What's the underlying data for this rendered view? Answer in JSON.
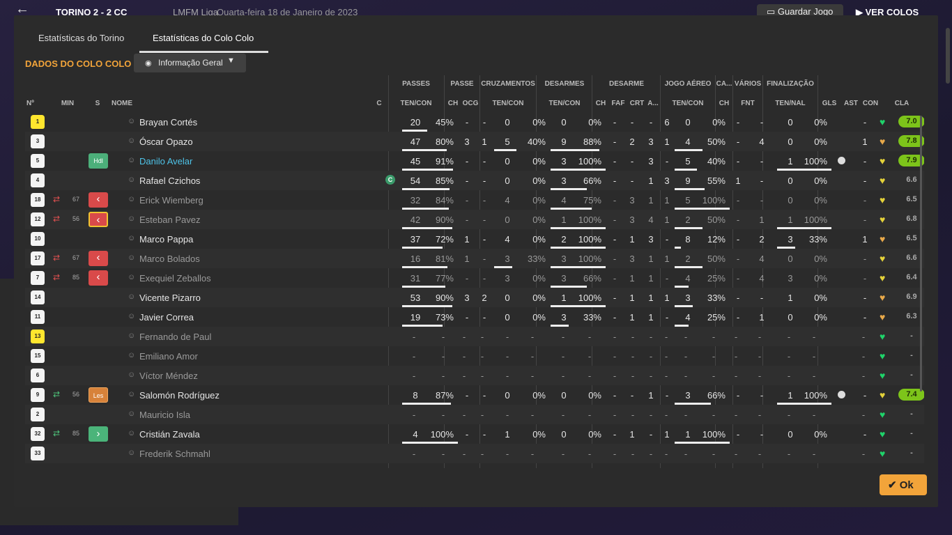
{
  "topbar": {
    "score": "TORINO  2 - 2  CC",
    "league": "LMFM Liga",
    "date": "Quarta-feira 18 de Janeiro de 2023",
    "save_label": "Guardar Jogo",
    "next_label": "VER COLOS"
  },
  "tabs": [
    "Estatísticas do Torino",
    "Estatísticas do Colo Colo"
  ],
  "section_title": "DADOS DO COLO COLO",
  "dropdown": {
    "label": "Informação Geral"
  },
  "group_headers": [
    "PASSES",
    "PASSE",
    "CRUZAMENTOS",
    "DESARMES",
    "DESARME",
    "JOGO AÉREO",
    "CA...",
    "VÁRIOS",
    "FINALIZAÇÃO"
  ],
  "columns": [
    "Nº",
    "MIN",
    "S",
    "NOME",
    "C",
    "TEN/CON",
    "CH",
    "OCG",
    "TEN/CON",
    "TEN/CON",
    "CH",
    "FAF",
    "CRT",
    "A...",
    "TEN/CON",
    "CH",
    "FNT",
    "TEN/NAL",
    "GLS",
    "AST",
    "CON",
    "CLA"
  ],
  "colors": {
    "accent": "#f2a43a",
    "highlight_name": "#4ec3e8",
    "rating_green": "#7dc41a"
  },
  "players": [
    {
      "num": "1",
      "gk": true,
      "min": "",
      "sub": "",
      "badge": "",
      "name": "Brayan Cortés",
      "dim": false,
      "cap": false,
      "p": [
        "20",
        "45%"
      ],
      "pr": 0.45,
      "pch": "-",
      "pocg": "-",
      "cz": [
        "0",
        "0%"
      ],
      "czr": 0,
      "ds": [
        "0",
        "0%"
      ],
      "dsr": 0,
      "dch": "-",
      "faf": "-",
      "crt": "-",
      "a": "6",
      "ja": [
        "0",
        "0%"
      ],
      "jar": 0,
      "cach": "-",
      "fnt": "-",
      "fin": [
        "0",
        "0%"
      ],
      "finr": 0,
      "gls": false,
      "ast": "-",
      "con": "green",
      "cla": "7.0",
      "cla_hi": true
    },
    {
      "num": "3",
      "gk": false,
      "min": "",
      "sub": "",
      "badge": "",
      "name": "Óscar Opazo",
      "dim": false,
      "cap": false,
      "p": [
        "47",
        "80%"
      ],
      "pr": 0.8,
      "pch": "3",
      "pocg": "1",
      "cz": [
        "5",
        "40%"
      ],
      "czr": 0.4,
      "ds": [
        "9",
        "88%"
      ],
      "dsr": 0.88,
      "dch": "-",
      "faf": "2",
      "crt": "3",
      "a": "1",
      "ja": [
        "4",
        "50%"
      ],
      "jar": 0.5,
      "cach": "-",
      "fnt": "4",
      "fin": [
        "0",
        "0%"
      ],
      "finr": 0,
      "gls": false,
      "ast": "1",
      "con": "orange",
      "cla": "7.8",
      "cla_hi": true
    },
    {
      "num": "5",
      "gk": false,
      "min": "",
      "sub": "",
      "badge": "Hdl",
      "name": "Danilo Avelar",
      "dim": false,
      "blue": true,
      "cap": false,
      "p": [
        "45",
        "91%"
      ],
      "pr": 0.91,
      "pch": "-",
      "pocg": "-",
      "cz": [
        "0",
        "0%"
      ],
      "czr": 0,
      "ds": [
        "3",
        "100%"
      ],
      "dsr": 1,
      "dch": "-",
      "faf": "-",
      "crt": "3",
      "a": "-",
      "ja": [
        "5",
        "40%"
      ],
      "jar": 0.4,
      "cach": "-",
      "fnt": "-",
      "fin": [
        "1",
        "100%"
      ],
      "finr": 1,
      "gls": true,
      "ast": "-",
      "con": "yellow",
      "cla": "7.9",
      "cla_hi": true
    },
    {
      "num": "4",
      "gk": false,
      "min": "",
      "sub": "",
      "badge": "",
      "name": "Rafael Czichos",
      "dim": false,
      "cap": true,
      "p": [
        "54",
        "85%"
      ],
      "pr": 0.85,
      "pch": "-",
      "pocg": "-",
      "cz": [
        "0",
        "0%"
      ],
      "czr": 0,
      "ds": [
        "3",
        "66%"
      ],
      "dsr": 0.66,
      "dch": "-",
      "faf": "-",
      "crt": "1",
      "a": "3",
      "ja": [
        "9",
        "55%"
      ],
      "jar": 0.55,
      "cach": "1",
      "fnt": "-",
      "fin": [
        "0",
        "0%"
      ],
      "finr": 0,
      "gls": false,
      "ast": "-",
      "con": "yellow",
      "cla": "6.6",
      "cla_hi": false
    },
    {
      "num": "18",
      "gk": false,
      "min": "67",
      "sub": "out",
      "badge": "red-out",
      "name": "Erick Wiemberg",
      "dim": true,
      "cap": false,
      "p": [
        "32",
        "84%"
      ],
      "pr": 0.84,
      "pch": "-",
      "pocg": "-",
      "cz": [
        "4",
        "0%"
      ],
      "czr": 0,
      "ds": [
        "4",
        "75%"
      ],
      "dsr": 0.75,
      "dch": "-",
      "faf": "3",
      "crt": "1",
      "a": "1",
      "ja": [
        "5",
        "100%"
      ],
      "jar": 1,
      "cach": "-",
      "fnt": "-",
      "fin": [
        "0",
        "0%"
      ],
      "finr": 0,
      "gls": false,
      "ast": "-",
      "con": "yellow",
      "cla": "6.5",
      "cla_hi": false
    },
    {
      "num": "12",
      "gk": false,
      "min": "56",
      "sub": "out",
      "badge": "red-out-y",
      "name": "Esteban Pavez",
      "dim": true,
      "cap": false,
      "p": [
        "42",
        "90%"
      ],
      "pr": 0.9,
      "pch": "-",
      "pocg": "-",
      "cz": [
        "0",
        "0%"
      ],
      "czr": 0,
      "ds": [
        "1",
        "100%"
      ],
      "dsr": 1,
      "dch": "-",
      "faf": "3",
      "crt": "4",
      "a": "1",
      "ja": [
        "2",
        "50%"
      ],
      "jar": 0.5,
      "cach": "-",
      "fnt": "1",
      "fin": [
        "1",
        "100%"
      ],
      "finr": 1,
      "gls": false,
      "ast": "-",
      "con": "yellow",
      "cla": "6.8",
      "cla_hi": false
    },
    {
      "num": "10",
      "gk": false,
      "min": "",
      "sub": "",
      "badge": "",
      "name": "Marco Pappa",
      "dim": false,
      "cap": false,
      "p": [
        "37",
        "72%"
      ],
      "pr": 0.72,
      "pch": "1",
      "pocg": "-",
      "cz": [
        "4",
        "0%"
      ],
      "czr": 0,
      "ds": [
        "2",
        "100%"
      ],
      "dsr": 1,
      "dch": "-",
      "faf": "1",
      "crt": "3",
      "a": "-",
      "ja": [
        "8",
        "12%"
      ],
      "jar": 0.12,
      "cach": "-",
      "fnt": "2",
      "fin": [
        "3",
        "33%"
      ],
      "finr": 0.33,
      "gls": false,
      "ast": "1",
      "con": "orange",
      "cla": "6.5",
      "cla_hi": false
    },
    {
      "num": "17",
      "gk": false,
      "min": "67",
      "sub": "out",
      "badge": "red-out",
      "name": "Marco Bolados",
      "dim": true,
      "cap": false,
      "p": [
        "16",
        "81%"
      ],
      "pr": 0.81,
      "pch": "1",
      "pocg": "-",
      "cz": [
        "3",
        "33%"
      ],
      "czr": 0.33,
      "ds": [
        "3",
        "100%"
      ],
      "dsr": 1,
      "dch": "-",
      "faf": "3",
      "crt": "1",
      "a": "1",
      "ja": [
        "2",
        "50%"
      ],
      "jar": 0.5,
      "cach": "-",
      "fnt": "4",
      "fin": [
        "0",
        "0%"
      ],
      "finr": 0,
      "gls": false,
      "ast": "-",
      "con": "yellow",
      "cla": "6.6",
      "cla_hi": false
    },
    {
      "num": "7",
      "gk": false,
      "min": "85",
      "sub": "out",
      "badge": "red-out",
      "name": "Exequiel Zeballos",
      "dim": true,
      "cap": false,
      "p": [
        "31",
        "77%"
      ],
      "pr": 0.77,
      "pch": "-",
      "pocg": "-",
      "cz": [
        "3",
        "0%"
      ],
      "czr": 0,
      "ds": [
        "3",
        "66%"
      ],
      "dsr": 0.66,
      "dch": "-",
      "faf": "1",
      "crt": "1",
      "a": "-",
      "ja": [
        "4",
        "25%"
      ],
      "jar": 0.25,
      "cach": "-",
      "fnt": "4",
      "fin": [
        "3",
        "0%"
      ],
      "finr": 0,
      "gls": false,
      "ast": "-",
      "con": "yellow",
      "cla": "6.4",
      "cla_hi": false
    },
    {
      "num": "14",
      "gk": false,
      "min": "",
      "sub": "",
      "badge": "",
      "name": "Vicente Pizarro",
      "dim": false,
      "cap": false,
      "p": [
        "53",
        "90%"
      ],
      "pr": 0.9,
      "pch": "3",
      "pocg": "2",
      "cz": [
        "0",
        "0%"
      ],
      "czr": 0,
      "ds": [
        "1",
        "100%"
      ],
      "dsr": 1,
      "dch": "-",
      "faf": "1",
      "crt": "1",
      "a": "1",
      "ja": [
        "3",
        "33%"
      ],
      "jar": 0.33,
      "cach": "-",
      "fnt": "-",
      "fin": [
        "1",
        "0%"
      ],
      "finr": 0,
      "gls": false,
      "ast": "-",
      "con": "orange",
      "cla": "6.9",
      "cla_hi": false
    },
    {
      "num": "11",
      "gk": false,
      "min": "",
      "sub": "",
      "badge": "",
      "name": "Javier Correa",
      "dim": false,
      "cap": false,
      "p": [
        "19",
        "73%"
      ],
      "pr": 0.73,
      "pch": "-",
      "pocg": "-",
      "cz": [
        "0",
        "0%"
      ],
      "czr": 0,
      "ds": [
        "3",
        "33%"
      ],
      "dsr": 0.33,
      "dch": "-",
      "faf": "1",
      "crt": "1",
      "a": "-",
      "ja": [
        "4",
        "25%"
      ],
      "jar": 0.25,
      "cach": "-",
      "fnt": "1",
      "fin": [
        "0",
        "0%"
      ],
      "finr": 0,
      "gls": false,
      "ast": "-",
      "con": "orange",
      "cla": "6.3",
      "cla_hi": false
    },
    {
      "num": "13",
      "gk": true,
      "min": "",
      "sub": "",
      "badge": "",
      "name": "Fernando de Paul",
      "dim": true,
      "cap": false,
      "empty": true,
      "con": "green",
      "cla": "-",
      "cla_hi": false
    },
    {
      "num": "15",
      "gk": false,
      "min": "",
      "sub": "",
      "badge": "",
      "name": "Emiliano Amor",
      "dim": true,
      "cap": false,
      "empty": true,
      "con": "green",
      "cla": "-",
      "cla_hi": false
    },
    {
      "num": "6",
      "gk": false,
      "min": "",
      "sub": "",
      "badge": "",
      "name": "Víctor Méndez",
      "dim": true,
      "cap": false,
      "empty": true,
      "con": "green",
      "cla": "-",
      "cla_hi": false
    },
    {
      "num": "9",
      "gk": false,
      "min": "56",
      "sub": "in",
      "badge": "Les",
      "name": "Salomón Rodríguez",
      "dim": false,
      "cap": false,
      "p": [
        "8",
        "87%"
      ],
      "pr": 0.87,
      "pch": "-",
      "pocg": "-",
      "cz": [
        "0",
        "0%"
      ],
      "czr": 0,
      "ds": [
        "0",
        "0%"
      ],
      "dsr": 0,
      "dch": "-",
      "faf": "-",
      "crt": "1",
      "a": "-",
      "ja": [
        "3",
        "66%"
      ],
      "jar": 0.66,
      "cach": "-",
      "fnt": "-",
      "fin": [
        "1",
        "100%"
      ],
      "finr": 1,
      "gls": true,
      "ast": "-",
      "con": "yellow",
      "cla": "7.4",
      "cla_hi": true
    },
    {
      "num": "2",
      "gk": false,
      "min": "",
      "sub": "",
      "badge": "",
      "name": "Mauricio Isla",
      "dim": true,
      "cap": false,
      "empty": true,
      "con": "green",
      "cla": "-",
      "cla_hi": false
    },
    {
      "num": "32",
      "gk": false,
      "min": "85",
      "sub": "in",
      "badge": "green-in",
      "name": "Cristián Zavala",
      "dim": false,
      "cap": false,
      "p": [
        "4",
        "100%"
      ],
      "pr": 1,
      "pch": "-",
      "pocg": "-",
      "cz": [
        "1",
        "0%"
      ],
      "czr": 0,
      "ds": [
        "0",
        "0%"
      ],
      "dsr": 0,
      "dch": "-",
      "faf": "1",
      "crt": "-",
      "a": "1",
      "ja": [
        "1",
        "100%"
      ],
      "jar": 1,
      "cach": "-",
      "fnt": "-",
      "fin": [
        "0",
        "0%"
      ],
      "finr": 0,
      "gls": false,
      "ast": "-",
      "con": "green",
      "cla": "-",
      "cla_hi": false
    },
    {
      "num": "33",
      "gk": false,
      "min": "",
      "sub": "",
      "badge": "",
      "name": "Frederik Schmahl",
      "dim": true,
      "cap": false,
      "empty": true,
      "con": "green",
      "cla": "-",
      "cla_hi": false
    }
  ],
  "ok_label": "Ok"
}
